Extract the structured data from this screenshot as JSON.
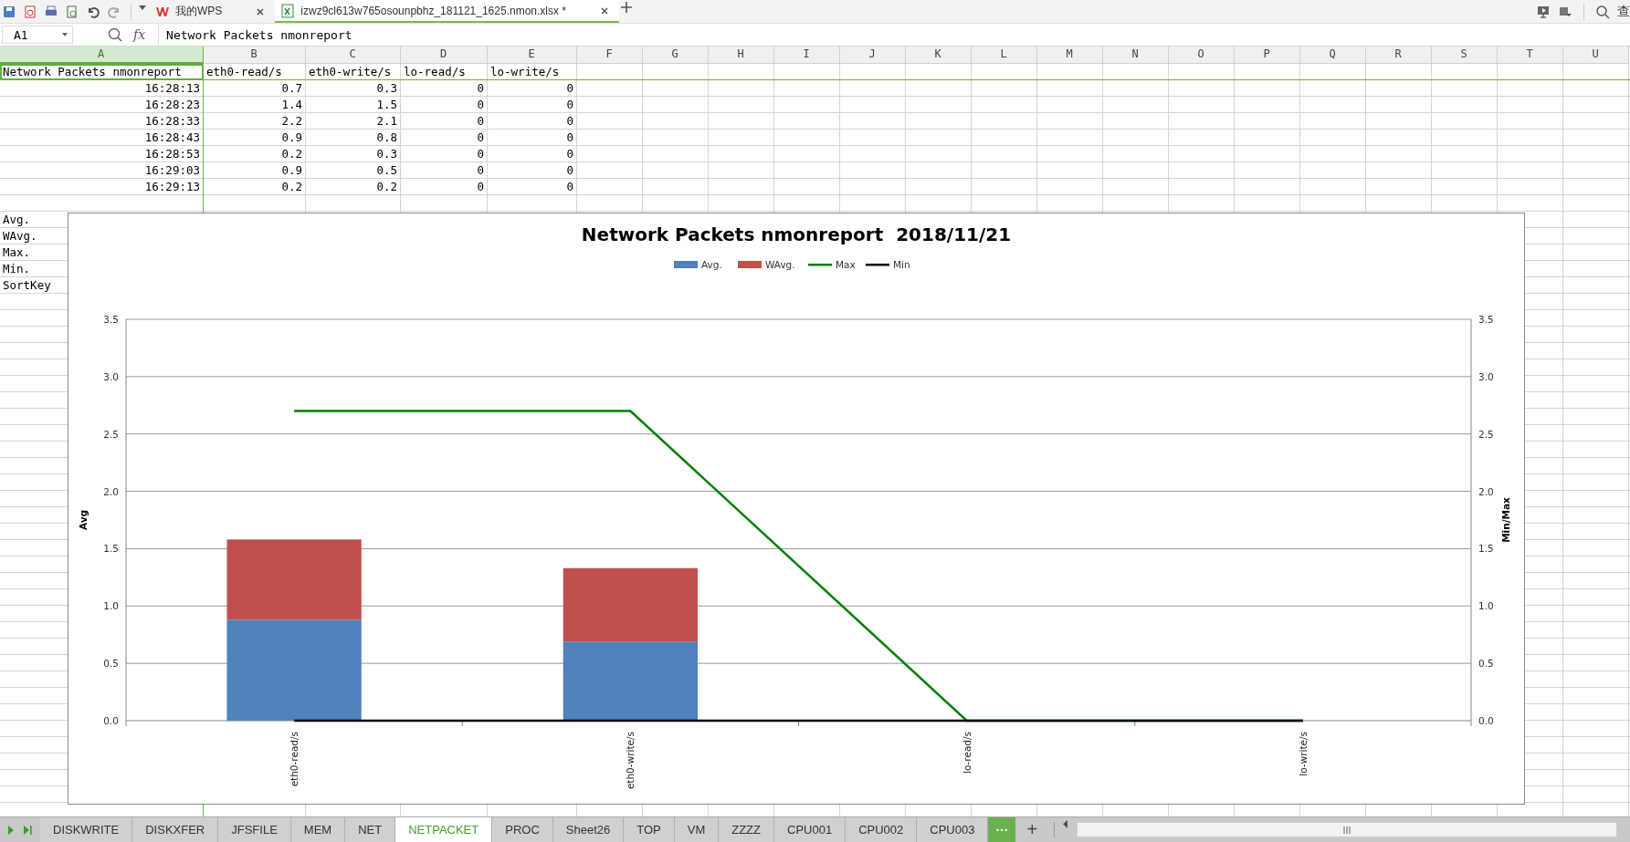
{
  "title_bar": {
    "tabs": [
      {
        "kind": "home",
        "label": "我的WPS",
        "selected": false
      },
      {
        "kind": "file",
        "label": "izwz9cl613w765osounpbhz_181121_1625.nmon.xlsx *",
        "selected": true
      }
    ],
    "search_label": "查"
  },
  "formula_bar": {
    "name_box": "A1",
    "fx": "fx",
    "formula": "Network Packets nmonreport"
  },
  "columns": [
    {
      "label": "A",
      "selected": true
    },
    {
      "label": "B",
      "selected": false
    },
    {
      "label": "C",
      "selected": false
    },
    {
      "label": "D",
      "selected": false
    },
    {
      "label": "E",
      "selected": false
    },
    {
      "label": "F",
      "selected": false
    },
    {
      "label": "G",
      "selected": false
    },
    {
      "label": "H",
      "selected": false
    },
    {
      "label": "I",
      "selected": false
    },
    {
      "label": "J",
      "selected": false
    },
    {
      "label": "K",
      "selected": false
    },
    {
      "label": "L",
      "selected": false
    },
    {
      "label": "M",
      "selected": false
    },
    {
      "label": "N",
      "selected": false
    },
    {
      "label": "O",
      "selected": false
    },
    {
      "label": "P",
      "selected": false
    },
    {
      "label": "Q",
      "selected": false
    },
    {
      "label": "R",
      "selected": false
    },
    {
      "label": "S",
      "selected": false
    },
    {
      "label": "T",
      "selected": false
    },
    {
      "label": "U",
      "selected": false
    }
  ],
  "rows": [
    {
      "kind": "text",
      "cells": [
        "Network Packets nmonreport",
        "eth0-read/s",
        "eth0-write/s",
        "lo-read/s",
        "lo-write/s"
      ]
    },
    {
      "kind": "data",
      "cells": [
        "16:28:13",
        "0.7",
        "0.3",
        "0",
        "0"
      ]
    },
    {
      "kind": "data",
      "cells": [
        "16:28:23",
        "1.4",
        "1.5",
        "0",
        "0"
      ]
    },
    {
      "kind": "data",
      "cells": [
        "16:28:33",
        "2.2",
        "2.1",
        "0",
        "0"
      ]
    },
    {
      "kind": "data",
      "cells": [
        "16:28:43",
        "0.9",
        "0.8",
        "0",
        "0"
      ]
    },
    {
      "kind": "data",
      "cells": [
        "16:28:53",
        "0.2",
        "0.3",
        "0",
        "0"
      ]
    },
    {
      "kind": "data",
      "cells": [
        "16:29:03",
        "0.9",
        "0.5",
        "0",
        "0"
      ]
    },
    {
      "kind": "data",
      "cells": [
        "16:29:13",
        "0.2",
        "0.2",
        "0",
        "0"
      ]
    }
  ],
  "stat_labels": [
    "Avg.",
    "WAvg.",
    "Max.",
    "Min.",
    "SortKey"
  ],
  "chart": {
    "chart_data": {
      "type": "bar",
      "title": "Network Packets nmonreport  2018/11/21",
      "ylabel": "Avg",
      "y2label": "Min/Max",
      "stacked": true,
      "grid": true,
      "legend": "top",
      "categories": [
        "eth0-read/s",
        "eth0-write/s",
        "lo-read/s",
        "lo-write/s"
      ],
      "ylim": [
        0,
        3.5
      ],
      "yticks": [
        {
          "value": 0,
          "label": "0.0"
        },
        {
          "value": 0.5,
          "label": "0.5"
        },
        {
          "value": 1,
          "label": "1.0"
        },
        {
          "value": 1.5,
          "label": "1.5"
        },
        {
          "value": 2,
          "label": "2.0"
        },
        {
          "value": 2.5,
          "label": "2.5"
        },
        {
          "value": 3,
          "label": "3.0"
        },
        {
          "value": 3.5,
          "label": "3.5"
        }
      ],
      "series": [
        {
          "name": "Avg.",
          "type": "bar",
          "color": "#4f81bd",
          "values": [
            0.88,
            0.69,
            0,
            0
          ]
        },
        {
          "name": "WAvg.",
          "type": "bar",
          "color": "#c0504d",
          "values": [
            0.7,
            0.64,
            0,
            0
          ]
        },
        {
          "name": "Max",
          "type": "line",
          "color": "#008000",
          "values": [
            2.7,
            2.7,
            0,
            0
          ]
        },
        {
          "name": "Min",
          "type": "line",
          "color": "#000000",
          "values": [
            0,
            0,
            0,
            0
          ]
        }
      ]
    }
  },
  "sheet_tabs": [
    {
      "label": "DISKWRITE",
      "selected": false
    },
    {
      "label": "DISKXFER",
      "selected": false
    },
    {
      "label": "JFSFILE",
      "selected": false
    },
    {
      "label": "MEM",
      "selected": false
    },
    {
      "label": "NET",
      "selected": false
    },
    {
      "label": "NETPACKET",
      "selected": true
    },
    {
      "label": "PROC",
      "selected": false
    },
    {
      "label": "Sheet26",
      "selected": false
    },
    {
      "label": "TOP",
      "selected": false
    },
    {
      "label": "VM",
      "selected": false
    },
    {
      "label": "ZZZZ",
      "selected": false
    },
    {
      "label": "CPU001",
      "selected": false
    },
    {
      "label": "CPU002",
      "selected": false
    },
    {
      "label": "CPU003",
      "selected": false
    }
  ],
  "more_tabs_button": "···",
  "add_sheet_button": "+"
}
